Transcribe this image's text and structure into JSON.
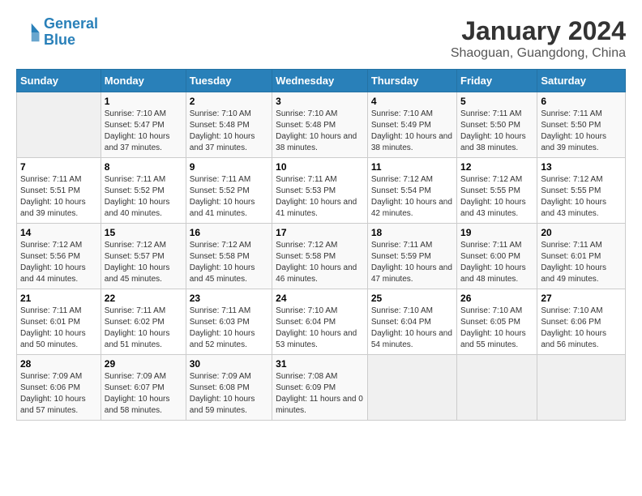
{
  "logo": {
    "line1": "General",
    "line2": "Blue"
  },
  "title": "January 2024",
  "subtitle": "Shaoguan, Guangdong, China",
  "days_of_week": [
    "Sunday",
    "Monday",
    "Tuesday",
    "Wednesday",
    "Thursday",
    "Friday",
    "Saturday"
  ],
  "weeks": [
    [
      {
        "date": "",
        "sunrise": "",
        "sunset": "",
        "daylight": ""
      },
      {
        "date": "1",
        "sunrise": "Sunrise: 7:10 AM",
        "sunset": "Sunset: 5:47 PM",
        "daylight": "Daylight: 10 hours and 37 minutes."
      },
      {
        "date": "2",
        "sunrise": "Sunrise: 7:10 AM",
        "sunset": "Sunset: 5:48 PM",
        "daylight": "Daylight: 10 hours and 37 minutes."
      },
      {
        "date": "3",
        "sunrise": "Sunrise: 7:10 AM",
        "sunset": "Sunset: 5:48 PM",
        "daylight": "Daylight: 10 hours and 38 minutes."
      },
      {
        "date": "4",
        "sunrise": "Sunrise: 7:10 AM",
        "sunset": "Sunset: 5:49 PM",
        "daylight": "Daylight: 10 hours and 38 minutes."
      },
      {
        "date": "5",
        "sunrise": "Sunrise: 7:11 AM",
        "sunset": "Sunset: 5:50 PM",
        "daylight": "Daylight: 10 hours and 38 minutes."
      },
      {
        "date": "6",
        "sunrise": "Sunrise: 7:11 AM",
        "sunset": "Sunset: 5:50 PM",
        "daylight": "Daylight: 10 hours and 39 minutes."
      }
    ],
    [
      {
        "date": "7",
        "sunrise": "Sunrise: 7:11 AM",
        "sunset": "Sunset: 5:51 PM",
        "daylight": "Daylight: 10 hours and 39 minutes."
      },
      {
        "date": "8",
        "sunrise": "Sunrise: 7:11 AM",
        "sunset": "Sunset: 5:52 PM",
        "daylight": "Daylight: 10 hours and 40 minutes."
      },
      {
        "date": "9",
        "sunrise": "Sunrise: 7:11 AM",
        "sunset": "Sunset: 5:52 PM",
        "daylight": "Daylight: 10 hours and 41 minutes."
      },
      {
        "date": "10",
        "sunrise": "Sunrise: 7:11 AM",
        "sunset": "Sunset: 5:53 PM",
        "daylight": "Daylight: 10 hours and 41 minutes."
      },
      {
        "date": "11",
        "sunrise": "Sunrise: 7:12 AM",
        "sunset": "Sunset: 5:54 PM",
        "daylight": "Daylight: 10 hours and 42 minutes."
      },
      {
        "date": "12",
        "sunrise": "Sunrise: 7:12 AM",
        "sunset": "Sunset: 5:55 PM",
        "daylight": "Daylight: 10 hours and 43 minutes."
      },
      {
        "date": "13",
        "sunrise": "Sunrise: 7:12 AM",
        "sunset": "Sunset: 5:55 PM",
        "daylight": "Daylight: 10 hours and 43 minutes."
      }
    ],
    [
      {
        "date": "14",
        "sunrise": "Sunrise: 7:12 AM",
        "sunset": "Sunset: 5:56 PM",
        "daylight": "Daylight: 10 hours and 44 minutes."
      },
      {
        "date": "15",
        "sunrise": "Sunrise: 7:12 AM",
        "sunset": "Sunset: 5:57 PM",
        "daylight": "Daylight: 10 hours and 45 minutes."
      },
      {
        "date": "16",
        "sunrise": "Sunrise: 7:12 AM",
        "sunset": "Sunset: 5:58 PM",
        "daylight": "Daylight: 10 hours and 45 minutes."
      },
      {
        "date": "17",
        "sunrise": "Sunrise: 7:12 AM",
        "sunset": "Sunset: 5:58 PM",
        "daylight": "Daylight: 10 hours and 46 minutes."
      },
      {
        "date": "18",
        "sunrise": "Sunrise: 7:11 AM",
        "sunset": "Sunset: 5:59 PM",
        "daylight": "Daylight: 10 hours and 47 minutes."
      },
      {
        "date": "19",
        "sunrise": "Sunrise: 7:11 AM",
        "sunset": "Sunset: 6:00 PM",
        "daylight": "Daylight: 10 hours and 48 minutes."
      },
      {
        "date": "20",
        "sunrise": "Sunrise: 7:11 AM",
        "sunset": "Sunset: 6:01 PM",
        "daylight": "Daylight: 10 hours and 49 minutes."
      }
    ],
    [
      {
        "date": "21",
        "sunrise": "Sunrise: 7:11 AM",
        "sunset": "Sunset: 6:01 PM",
        "daylight": "Daylight: 10 hours and 50 minutes."
      },
      {
        "date": "22",
        "sunrise": "Sunrise: 7:11 AM",
        "sunset": "Sunset: 6:02 PM",
        "daylight": "Daylight: 10 hours and 51 minutes."
      },
      {
        "date": "23",
        "sunrise": "Sunrise: 7:11 AM",
        "sunset": "Sunset: 6:03 PM",
        "daylight": "Daylight: 10 hours and 52 minutes."
      },
      {
        "date": "24",
        "sunrise": "Sunrise: 7:10 AM",
        "sunset": "Sunset: 6:04 PM",
        "daylight": "Daylight: 10 hours and 53 minutes."
      },
      {
        "date": "25",
        "sunrise": "Sunrise: 7:10 AM",
        "sunset": "Sunset: 6:04 PM",
        "daylight": "Daylight: 10 hours and 54 minutes."
      },
      {
        "date": "26",
        "sunrise": "Sunrise: 7:10 AM",
        "sunset": "Sunset: 6:05 PM",
        "daylight": "Daylight: 10 hours and 55 minutes."
      },
      {
        "date": "27",
        "sunrise": "Sunrise: 7:10 AM",
        "sunset": "Sunset: 6:06 PM",
        "daylight": "Daylight: 10 hours and 56 minutes."
      }
    ],
    [
      {
        "date": "28",
        "sunrise": "Sunrise: 7:09 AM",
        "sunset": "Sunset: 6:06 PM",
        "daylight": "Daylight: 10 hours and 57 minutes."
      },
      {
        "date": "29",
        "sunrise": "Sunrise: 7:09 AM",
        "sunset": "Sunset: 6:07 PM",
        "daylight": "Daylight: 10 hours and 58 minutes."
      },
      {
        "date": "30",
        "sunrise": "Sunrise: 7:09 AM",
        "sunset": "Sunset: 6:08 PM",
        "daylight": "Daylight: 10 hours and 59 minutes."
      },
      {
        "date": "31",
        "sunrise": "Sunrise: 7:08 AM",
        "sunset": "Sunset: 6:09 PM",
        "daylight": "Daylight: 11 hours and 0 minutes."
      },
      {
        "date": "",
        "sunrise": "",
        "sunset": "",
        "daylight": ""
      },
      {
        "date": "",
        "sunrise": "",
        "sunset": "",
        "daylight": ""
      },
      {
        "date": "",
        "sunrise": "",
        "sunset": "",
        "daylight": ""
      }
    ]
  ]
}
